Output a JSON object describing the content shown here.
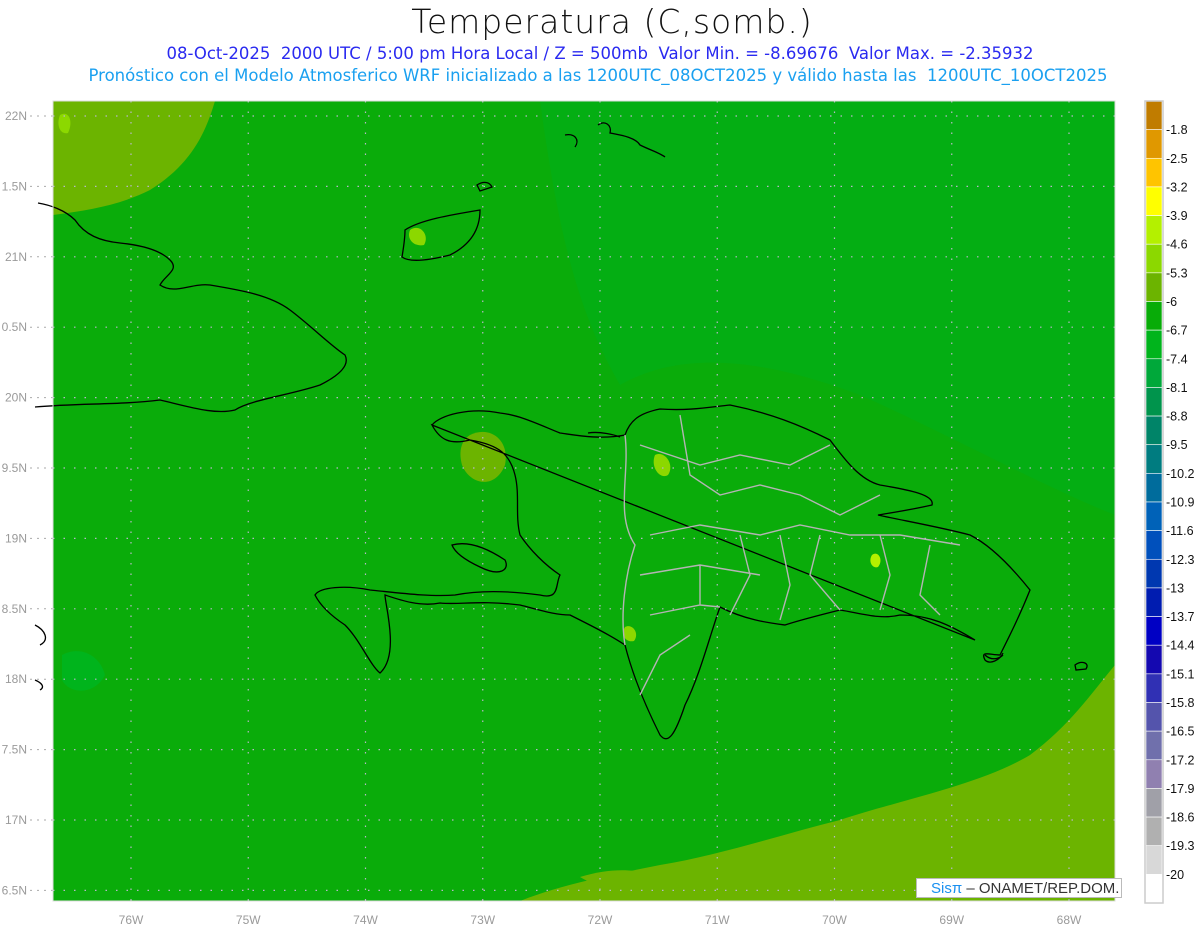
{
  "header": {
    "title": "Temperatura (C,somb.)",
    "subtitle1": "08-Oct-2025  2000 UTC / 5:00 pm Hora Local / Z = 500mb  Valor Min. = -8.69676  Valor Max. = -2.35932",
    "subtitle2": "Pronóstico con el Modelo Atmosferico WRF inicializado a las 1200UTC_08OCT2025 y válido hasta las  1200UTC_10OCT2025"
  },
  "watermark": {
    "logo": "Sisπ",
    "text": " – ONAMET/REP.DOM."
  },
  "chart_data": {
    "type": "heatmap",
    "title": "Temperatura (C,somb.)",
    "variable": "Temperature at 500mb (C)",
    "value_min": -8.69676,
    "value_max": -2.35932,
    "x_ticks": [
      {
        "value": -76,
        "label": "76W"
      },
      {
        "value": -75,
        "label": "75W"
      },
      {
        "value": -74,
        "label": "74W"
      },
      {
        "value": -73,
        "label": "73W"
      },
      {
        "value": -72,
        "label": "72W"
      },
      {
        "value": -71,
        "label": "71W"
      },
      {
        "value": -70,
        "label": "70W"
      },
      {
        "value": -69,
        "label": "69W"
      },
      {
        "value": -68,
        "label": "68W"
      }
    ],
    "y_ticks": [
      {
        "value": 22,
        "label": "22N"
      },
      {
        "value": 21.5,
        "label": "1.5N"
      },
      {
        "value": 21,
        "label": "21N"
      },
      {
        "value": 20.5,
        "label": "0.5N"
      },
      {
        "value": 20,
        "label": "20N"
      },
      {
        "value": 19.5,
        "label": "9.5N"
      },
      {
        "value": 19,
        "label": "19N"
      },
      {
        "value": 18.5,
        "label": "8.5N"
      },
      {
        "value": 18,
        "label": "18N"
      },
      {
        "value": 17.5,
        "label": "7.5N"
      },
      {
        "value": 17,
        "label": "17N"
      },
      {
        "value": 16.5,
        "label": "6.5N"
      }
    ],
    "xlim": [
      -76.67,
      -67.62
    ],
    "ylim": [
      16.4,
      22.1
    ],
    "grid": true,
    "colorbar": {
      "labels": [
        "-1.8",
        "-2.5",
        "-3.2",
        "-3.9",
        "-4.6",
        "-5.3",
        "-6",
        "-6.7",
        "-7.4",
        "-8.1",
        "-8.8",
        "-9.5",
        "-10.2",
        "-10.9",
        "-11.6",
        "-12.3",
        "-13",
        "-13.7",
        "-14.4",
        "-15.1",
        "-15.8",
        "-16.5",
        "-17.2",
        "-17.9",
        "-18.6",
        "-19.3",
        "-20"
      ],
      "colors": [
        "#c07c00",
        "#e09800",
        "#ffc400",
        "#ffff00",
        "#b4f000",
        "#8cd800",
        "#6cb400",
        "#08ac08",
        "#00b41c",
        "#00a83a",
        "#00944c",
        "#008468",
        "#007c80",
        "#006c9c",
        "#0062b8",
        "#0050bc",
        "#0038b0",
        "#001cb0",
        "#0000c4",
        "#1408b0",
        "#3030b4",
        "#5454ac",
        "#7070ac",
        "#9080b0",
        "#a0a0a8",
        "#b0b0b0",
        "#d8d8d8",
        "#ffffff"
      ],
      "placement": "right"
    },
    "dominant_range": [
      -6.7,
      -6.0
    ]
  }
}
